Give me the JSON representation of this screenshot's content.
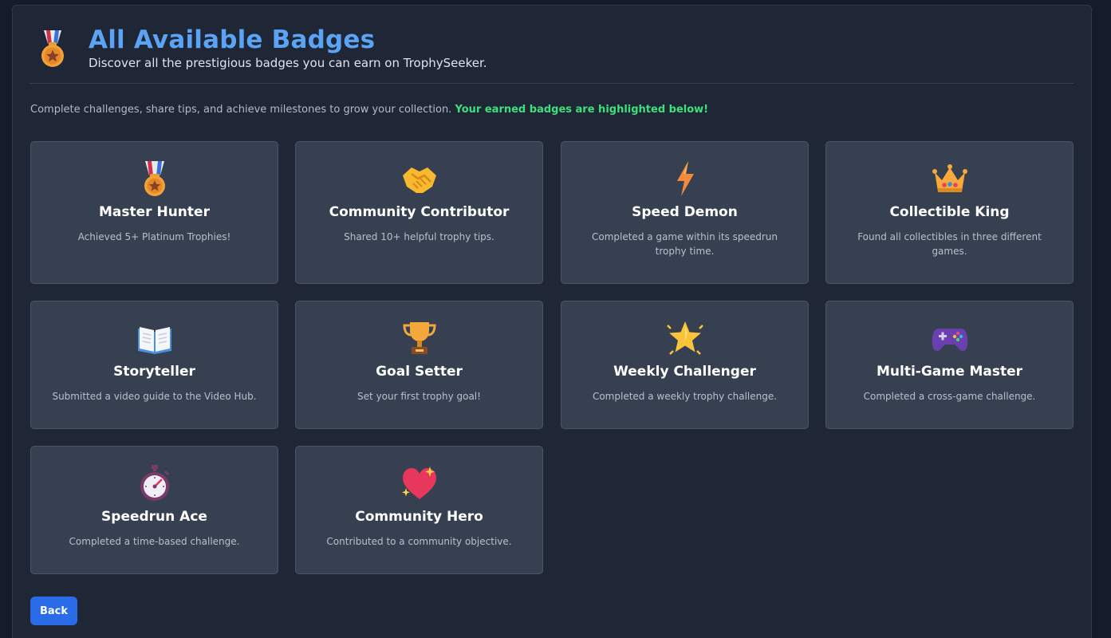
{
  "header": {
    "title": "All Available Badges",
    "subtitle": "Discover all the prestigious badges you can earn on TrophySeeker.",
    "icon": "medal-icon"
  },
  "intro": {
    "text": "Complete challenges, share tips, and achieve milestones to grow your collection.",
    "highlight": "Your earned badges are highlighted below!"
  },
  "badges": [
    {
      "name": "Master Hunter",
      "description": "Achieved 5+ Platinum Trophies!",
      "icon": "medal-icon"
    },
    {
      "name": "Community Contributor",
      "description": "Shared 10+ helpful trophy tips.",
      "icon": "handshake-icon"
    },
    {
      "name": "Speed Demon",
      "description": "Completed a game within its speedrun trophy time.",
      "icon": "lightning-icon"
    },
    {
      "name": "Collectible King",
      "description": "Found all collectibles in three different games.",
      "icon": "crown-icon"
    },
    {
      "name": "Storyteller",
      "description": "Submitted a video guide to the Video Hub.",
      "icon": "open-book-icon"
    },
    {
      "name": "Goal Setter",
      "description": "Set your first trophy goal!",
      "icon": "trophy-icon"
    },
    {
      "name": "Weekly Challenger",
      "description": "Completed a weekly trophy challenge.",
      "icon": "glowing-star-icon"
    },
    {
      "name": "Multi-Game Master",
      "description": "Completed a cross-game challenge.",
      "icon": "game-controller-icon"
    },
    {
      "name": "Speedrun Ace",
      "description": "Completed a time-based challenge.",
      "icon": "stopwatch-icon"
    },
    {
      "name": "Community Hero",
      "description": "Contributed to a community objective.",
      "icon": "sparkling-heart-icon"
    }
  ],
  "back_label": "Back",
  "colors": {
    "accent": "#5aa3f5",
    "highlight": "#3ee07c",
    "button": "#2a6be8",
    "card": "#374051"
  }
}
